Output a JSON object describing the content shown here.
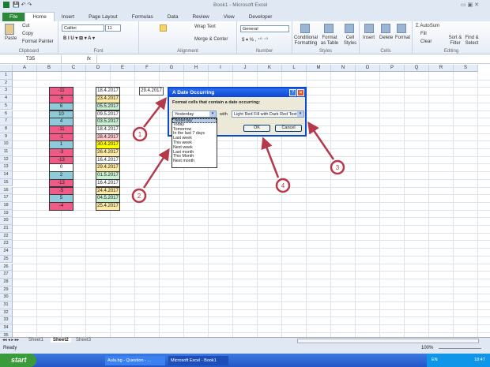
{
  "window": {
    "title": "Book1 - Microsoft Excel"
  },
  "tabs": [
    "File",
    "Home",
    "Insert",
    "Page Layout",
    "Formulas",
    "Data",
    "Review",
    "View",
    "Developer"
  ],
  "ribbon": {
    "clipboard": {
      "label": "Clipboard",
      "paste": "Paste",
      "cut": "Cut",
      "copy": "Copy",
      "format_painter": "Format Painter"
    },
    "font": {
      "label": "Font",
      "name": "Calibri",
      "size": "11"
    },
    "alignment": {
      "label": "Alignment",
      "wrap": "Wrap Text",
      "merge": "Merge & Center"
    },
    "number": {
      "label": "Number",
      "format": "General"
    },
    "styles": {
      "label": "Styles",
      "conditional": "Conditional Formatting",
      "table": "Format as Table",
      "cell": "Cell Styles"
    },
    "cells": {
      "label": "Cells",
      "insert": "Insert",
      "delete": "Delete",
      "format": "Format"
    },
    "editing": {
      "label": "Editing",
      "autosum": "AutoSum",
      "fill": "Fill",
      "clear": "Clear",
      "sort": "Sort & Filter",
      "find": "Find & Select"
    }
  },
  "formula": {
    "name_box": "T35",
    "fx": "fx",
    "value": ""
  },
  "columns": [
    "A",
    "B",
    "C",
    "D",
    "E",
    "F",
    "G",
    "H",
    "I",
    "J",
    "K",
    "L",
    "M",
    "N",
    "O",
    "P",
    "Q",
    "R",
    "S"
  ],
  "colB": [
    {
      "v": "-11",
      "c": "#ef5a87"
    },
    {
      "v": "-6",
      "c": "#ef5a87"
    },
    {
      "v": "6",
      "c": "#8ecad9"
    },
    {
      "v": "10",
      "c": "#8ecad9"
    },
    {
      "v": "4",
      "c": "#8ecad9"
    },
    {
      "v": "-11",
      "c": "#ef5a87"
    },
    {
      "v": "-1",
      "c": "#ef5a87"
    },
    {
      "v": "1",
      "c": "#8ecad9"
    },
    {
      "v": "-3",
      "c": "#ef5a87"
    },
    {
      "v": "-13",
      "c": "#ef5a87"
    },
    {
      "v": "0",
      "c": "#ffffff"
    },
    {
      "v": "2",
      "c": "#8ecad9"
    },
    {
      "v": "-13",
      "c": "#ef5a87"
    },
    {
      "v": "-5",
      "c": "#ef5a87"
    },
    {
      "v": "5",
      "c": "#8ecad9"
    },
    {
      "v": "-4",
      "c": "#ef5a87"
    }
  ],
  "colD": [
    {
      "v": "18.4.2017",
      "c": "#ffffff"
    },
    {
      "v": "23.4.2017",
      "c": "#fde9a6"
    },
    {
      "v": "05.5.2017",
      "c": "#c9efd2"
    },
    {
      "v": "09.5.2017",
      "c": "#ffffff"
    },
    {
      "v": "03.5.2017",
      "c": "#c9efd2"
    },
    {
      "v": "18.4.2017",
      "c": "#ffffff"
    },
    {
      "v": "28.4.2017",
      "c": "#ffc7ce"
    },
    {
      "v": "30.4.2017",
      "c": "#ffff00"
    },
    {
      "v": "26.4.2017",
      "c": "#fde9a6"
    },
    {
      "v": "16.4.2017",
      "c": "#ffffff"
    },
    {
      "v": "29.4.2017",
      "c": "#fde9a6"
    },
    {
      "v": "01.5.2017",
      "c": "#c9efd2"
    },
    {
      "v": "16.4.2017",
      "c": "#ffffff"
    },
    {
      "v": "24.4.2017",
      "c": "#fde9a6"
    },
    {
      "v": "04.5.2017",
      "c": "#c9efd2"
    },
    {
      "v": "25.4.2017",
      "c": "#fde9a6"
    }
  ],
  "F3": "29.4.2017",
  "dialog": {
    "title": "A Date Occurring",
    "heading": "Format cells that contain a date occurring:",
    "selected": "Yesterday",
    "with": "with",
    "format": "Light Red Fill with Dark Red Text",
    "ok": "OK",
    "cancel": "Cancel",
    "options": [
      "Yesterday",
      "Today",
      "Tomorrow",
      "In the last 7 days",
      "Last week",
      "This week",
      "Next week",
      "Last month",
      "This Month",
      "Next month"
    ]
  },
  "annotations": [
    "1",
    "2",
    "4",
    "3"
  ],
  "sheets": [
    "Sheet1",
    "Sheet2",
    "Sheet3"
  ],
  "status": {
    "ready": "Ready",
    "zoom": "100%"
  },
  "taskbar": {
    "start": "start",
    "items": [
      "Aula.bg - Question - ...",
      "Microsoft Excel - Book1"
    ],
    "lang": "EN",
    "time": "18:47"
  }
}
